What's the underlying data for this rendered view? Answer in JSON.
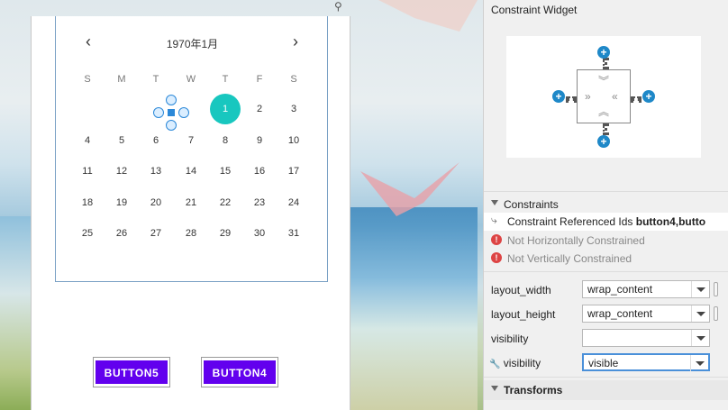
{
  "calendar": {
    "title": "1970年1月",
    "prev_icon": "‹",
    "next_icon": "›",
    "weekdays": [
      "S",
      "M",
      "T",
      "W",
      "T",
      "F",
      "S"
    ],
    "weeks": [
      [
        "",
        "",
        "",
        "",
        "1",
        "2",
        "3"
      ],
      [
        "4",
        "5",
        "6",
        "7",
        "8",
        "9",
        "10"
      ],
      [
        "11",
        "12",
        "13",
        "14",
        "15",
        "16",
        "17"
      ],
      [
        "18",
        "19",
        "20",
        "21",
        "22",
        "23",
        "24"
      ],
      [
        "25",
        "26",
        "27",
        "28",
        "29",
        "30",
        "31"
      ]
    ],
    "selected_day": "1"
  },
  "buttons": {
    "button5": "BUTTON5",
    "button4": "BUTTON4"
  },
  "panel": {
    "title": "Constraint Widget",
    "constraints_header": "Constraints",
    "referenced_ids_label": "Constraint Referenced Ids ",
    "referenced_ids_value": "button4,butto",
    "warning_horizontal": "Not Horizontally Constrained",
    "warning_vertical": "Not Vertically Constrained",
    "attributes": [
      {
        "label": "layout_width",
        "value": "wrap_content"
      },
      {
        "label": "layout_height",
        "value": "wrap_content"
      },
      {
        "label": "visibility",
        "value": ""
      },
      {
        "label": "visibility",
        "value": "visible"
      }
    ],
    "transforms_header": "Transforms"
  },
  "icons": {
    "plus": "+",
    "error": "!",
    "wrench": "🔧",
    "link": "⤷"
  }
}
